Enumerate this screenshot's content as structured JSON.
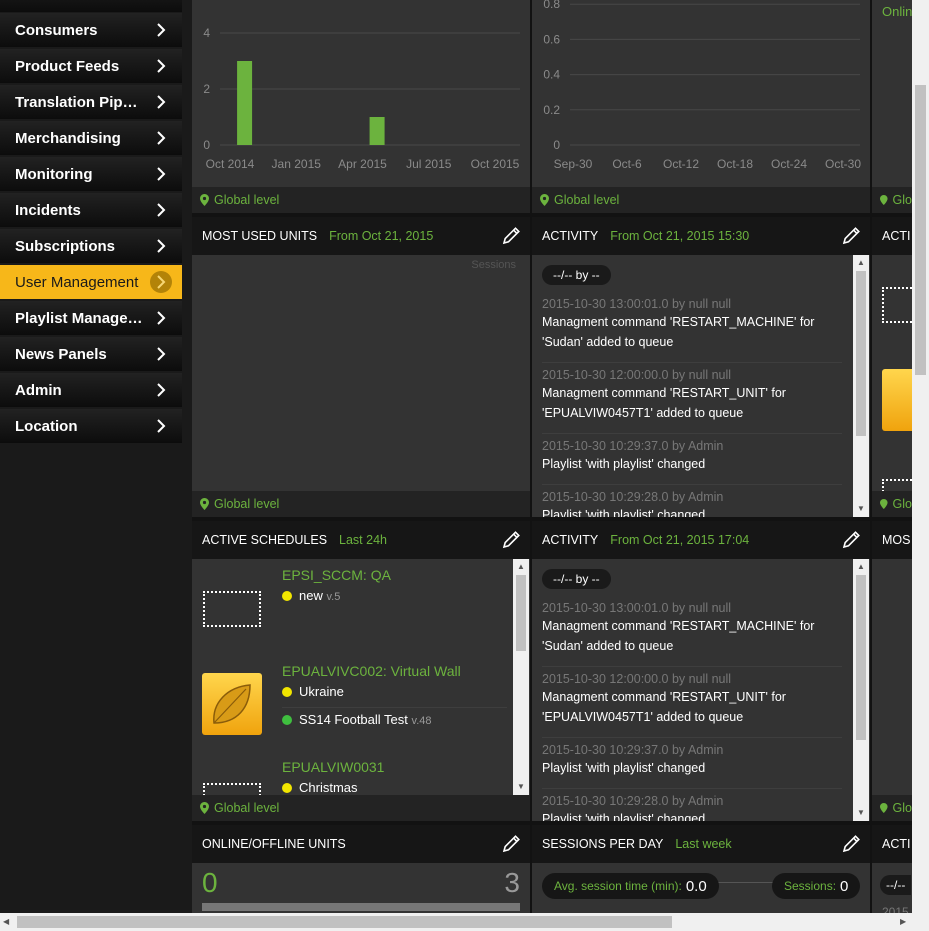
{
  "sidebar": {
    "items": [
      {
        "label": "Consumers"
      },
      {
        "label": "Product Feeds"
      },
      {
        "label": "Translation Pipelines"
      },
      {
        "label": "Merchandising"
      },
      {
        "label": "Monitoring"
      },
      {
        "label": "Incidents"
      },
      {
        "label": "Subscriptions"
      },
      {
        "label": "User Management",
        "active": true
      },
      {
        "label": "Playlist Management"
      },
      {
        "label": "News Panels"
      },
      {
        "label": "Admin"
      },
      {
        "label": "Location"
      }
    ]
  },
  "top_left_chart": {
    "footer": "Global level",
    "chart_data": {
      "type": "bar",
      "x_ticks": [
        "Oct 2014",
        "Jan 2015",
        "Apr 2015",
        "Jul 2015",
        "Oct 2015"
      ],
      "y_ticks": [
        "0",
        "2",
        "4"
      ],
      "bars": [
        {
          "x": "2014-11",
          "value": 3
        },
        {
          "x": "2015-05",
          "value": 1
        }
      ],
      "color": "#6cb33e"
    }
  },
  "top_mid_chart": {
    "footer": "Global level",
    "chart_data": {
      "type": "line",
      "x_ticks": [
        "Sep-30",
        "Oct-6",
        "Oct-12",
        "Oct-18",
        "Oct-24",
        "Oct-30"
      ],
      "y_ticks": [
        "0",
        "0.2",
        "0.4",
        "0.6",
        "0.8"
      ],
      "series": []
    }
  },
  "top_right_partial": {
    "text": "Onlin",
    "footer": "Glo"
  },
  "most_used_units": {
    "title": "MOST USED UNITS",
    "subtitle": "From Oct 21, 2015",
    "legend": "Sessions",
    "footer": "Global level"
  },
  "activity1": {
    "title": "ACTIVITY",
    "subtitle": "From Oct 21, 2015 15:30",
    "filter_label": "--/-- by --",
    "entries": [
      {
        "meta": "2015-10-30 13:00:01.0 by null null",
        "message": "Managment command 'RESTART_MACHINE' for 'Sudan' added to queue"
      },
      {
        "meta": "2015-10-30 12:00:00.0 by null null",
        "message": "Managment command 'RESTART_UNIT' for 'EPUALVIW0457T1' added to queue"
      },
      {
        "meta": "2015-10-30 10:29:37.0 by Admin",
        "message": "Playlist 'with playlist' changed"
      },
      {
        "meta": "2015-10-30 10:29:28.0 by Admin",
        "message": "Playlist 'with playlist' changed"
      }
    ]
  },
  "right_col_mid": {
    "title": "ACTI",
    "footer": "Glo"
  },
  "active_schedules": {
    "title": "ACTIVE SCHEDULES",
    "subtitle": "Last 24h",
    "footer": "Global level",
    "items": [
      {
        "name": "EPSI_SCCM: QA",
        "lines": [
          {
            "text": "new",
            "version": "v.5",
            "status_color": "#f2e600"
          }
        ]
      },
      {
        "name": "EPUALVIVC002: Virtual Wall",
        "lines": [
          {
            "text": "Ukraine",
            "version": "",
            "status_color": "#f2e600"
          },
          {
            "text": "SS14 Football Test",
            "version": "v.48",
            "status_color": "#3fbf3f"
          }
        ]
      },
      {
        "name": "EPUALVIW0031",
        "lines": [
          {
            "text": "Christmas",
            "version": "",
            "status_color": "#f2e600"
          }
        ]
      }
    ]
  },
  "activity2": {
    "title": "ACTIVITY",
    "subtitle": "From Oct 21, 2015 17:04",
    "filter_label": "--/-- by --",
    "entries": [
      {
        "meta": "2015-10-30 13:00:01.0 by null null",
        "message": "Managment command 'RESTART_MACHINE' for 'Sudan' added to queue"
      },
      {
        "meta": "2015-10-30 12:00:00.0 by null null",
        "message": "Managment command 'RESTART_UNIT' for 'EPUALVIW0457T1' added to queue"
      },
      {
        "meta": "2015-10-30 10:29:37.0 by Admin",
        "message": "Playlist 'with playlist' changed"
      },
      {
        "meta": "2015-10-30 10:29:28.0 by Admin",
        "message": "Playlist 'with playlist' changed"
      }
    ]
  },
  "right_col_low": {
    "title": "MOS",
    "footer": "Glo"
  },
  "online_offline": {
    "title": "ONLINE/OFFLINE UNITS",
    "online": "0",
    "offline": "3"
  },
  "sessions_per_day": {
    "title": "SESSIONS PER DAY",
    "subtitle": "Last week",
    "avg_label": "Avg. session time (min):",
    "avg_value": "0.0",
    "sessions_label": "Sessions:",
    "sessions_value": "0"
  },
  "right_col_bottom": {
    "title": "ACTI",
    "filter": "--/--",
    "meta": "2015"
  },
  "colors": {
    "accent_green": "#6cb33e",
    "active_nav": "#f7b719",
    "panel": "#333333",
    "header": "#161616"
  }
}
